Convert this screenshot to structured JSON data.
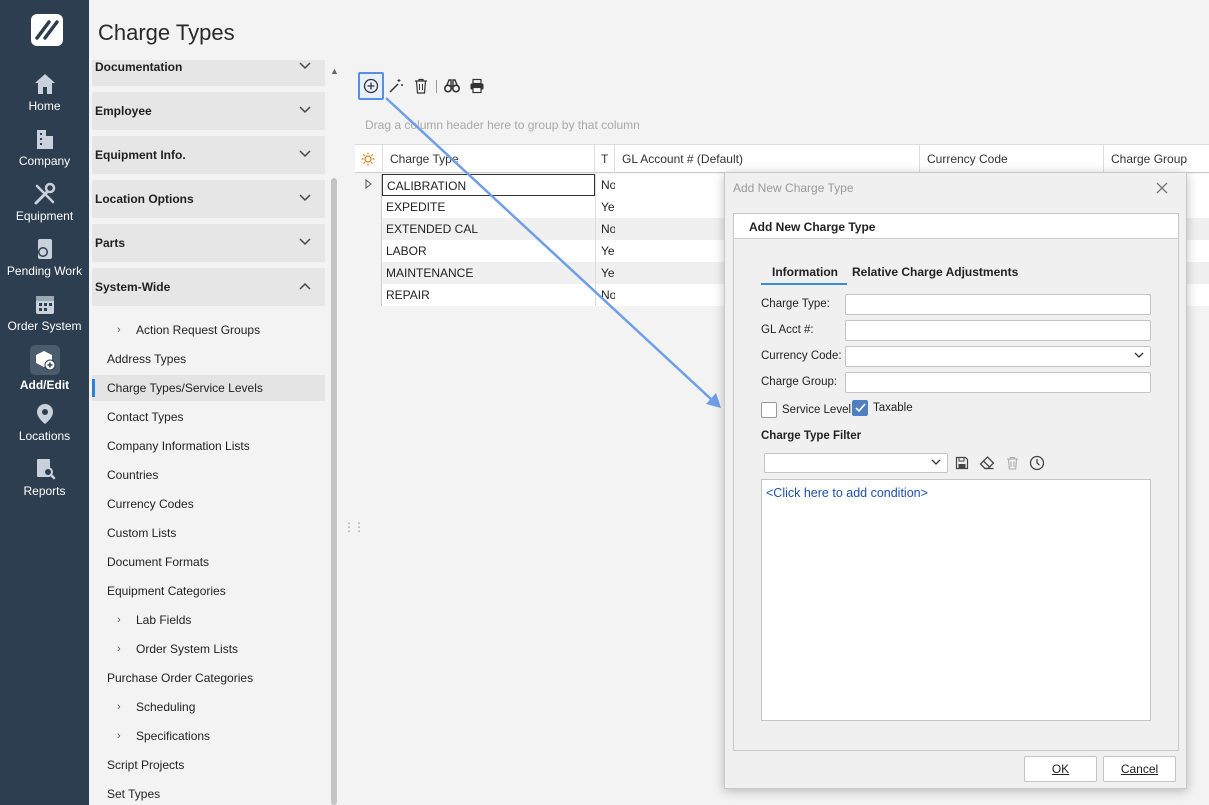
{
  "page": {
    "title": "Charge Types"
  },
  "nav": {
    "items": [
      {
        "label": "Home",
        "icon": "home-icon"
      },
      {
        "label": "Company",
        "icon": "building-icon"
      },
      {
        "label": "Equipment",
        "icon": "tools-icon"
      },
      {
        "label": "Pending Work",
        "icon": "pending-work-icon"
      },
      {
        "label": "Order System",
        "icon": "calendar-icon"
      },
      {
        "label": "Add/Edit",
        "icon": "add-edit-icon",
        "active": true
      },
      {
        "label": "Locations",
        "icon": "location-pin-icon"
      },
      {
        "label": "Reports",
        "icon": "report-search-icon"
      }
    ]
  },
  "tree": {
    "sections": [
      {
        "label": "Documentation",
        "expanded": false
      },
      {
        "label": "Employee",
        "expanded": false
      },
      {
        "label": "Equipment Info.",
        "expanded": false
      },
      {
        "label": "Location Options",
        "expanded": false
      },
      {
        "label": "Parts",
        "expanded": false
      },
      {
        "label": "System-Wide",
        "expanded": true
      }
    ],
    "items": [
      {
        "label": "Action Request Groups",
        "sub": true
      },
      {
        "label": "Address Types"
      },
      {
        "label": "Charge Types/Service Levels",
        "selected": true
      },
      {
        "label": "Contact Types"
      },
      {
        "label": "Company Information Lists"
      },
      {
        "label": "Countries"
      },
      {
        "label": "Currency Codes"
      },
      {
        "label": "Custom Lists"
      },
      {
        "label": "Document Formats"
      },
      {
        "label": "Equipment Categories"
      },
      {
        "label": "Lab Fields",
        "sub": true
      },
      {
        "label": "Order System Lists",
        "sub": true
      },
      {
        "label": "Purchase Order Categories"
      },
      {
        "label": "Scheduling",
        "sub": true
      },
      {
        "label": "Specifications",
        "sub": true
      },
      {
        "label": "Script Projects"
      },
      {
        "label": "Set Types"
      }
    ]
  },
  "toolbar": {
    "icons": [
      "add-circle-icon",
      "magic-wand-icon",
      "trash-icon",
      "binoculars-icon",
      "print-icon"
    ]
  },
  "grid": {
    "group_hint": "Drag a column header here to group by that column",
    "columns": [
      "Charge Type",
      "T",
      "GL Account # (Default)",
      "Currency Code",
      "Charge Group"
    ],
    "rows": [
      {
        "charge_type": "CALIBRATION",
        "t": "No"
      },
      {
        "charge_type": "EXPEDITE",
        "t": "Yes"
      },
      {
        "charge_type": "EXTENDED CAL",
        "t": "No"
      },
      {
        "charge_type": "LABOR",
        "t": "Yes"
      },
      {
        "charge_type": "MAINTENANCE",
        "t": "Yes"
      },
      {
        "charge_type": "REPAIR",
        "t": "No"
      }
    ]
  },
  "dialog": {
    "window_title": "Add New Charge Type",
    "header": "Add New Charge Type",
    "tabs": [
      "Information",
      "Relative Charge Adjustments"
    ],
    "fields": {
      "charge_type_label": "Charge Type:",
      "gl_acct_label": "GL Acct #:",
      "currency_code_label": "Currency Code:",
      "charge_group_label": "Charge Group:"
    },
    "service_level_label": "Service Level",
    "service_level_checked": false,
    "taxable_label": "Taxable",
    "taxable_checked": true,
    "filter_label": "Charge Type Filter",
    "condition_text": "<Click here to add condition>",
    "ok_label": "OK",
    "cancel_label": "Cancel"
  },
  "colors": {
    "rail": "#2c3e50",
    "accent": "#3a8ed8",
    "link": "#1f4fb0"
  }
}
